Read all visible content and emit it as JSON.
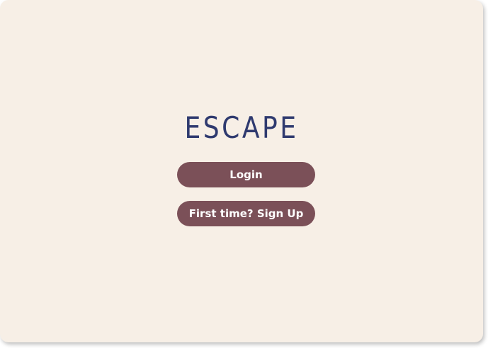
{
  "app": {
    "logo_text": "ESCAPE"
  },
  "actions": {
    "login_label": "Login",
    "signup_label": "First time? Sign Up"
  },
  "colors": {
    "background": "#f7efe6",
    "logo": "#2f3a6f",
    "button": "#7b5058",
    "button_text": "#ffffff"
  }
}
